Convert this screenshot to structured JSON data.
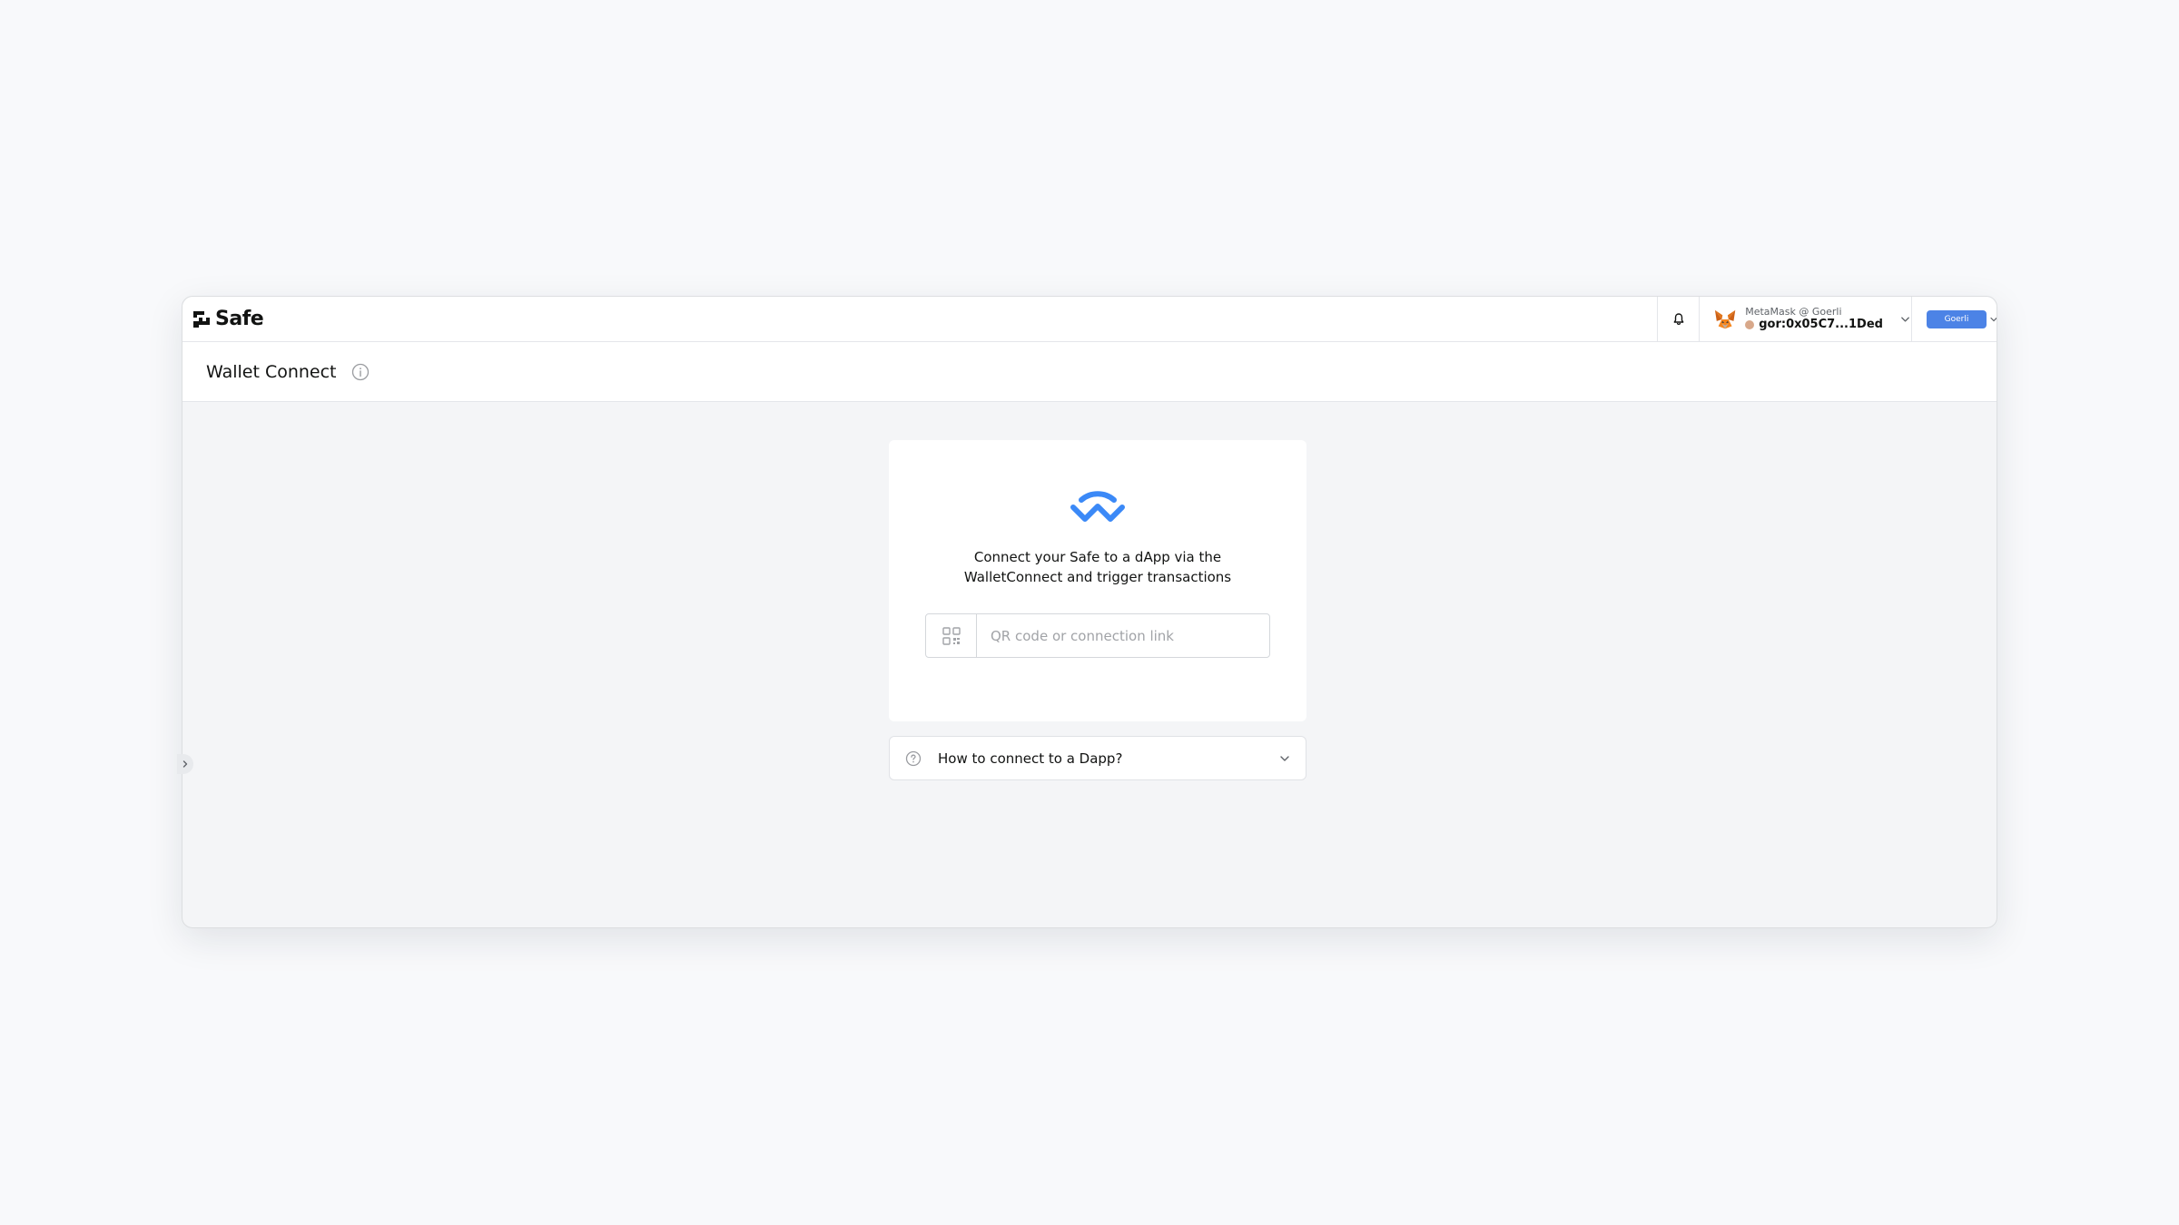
{
  "header": {
    "logo_text": "Safe",
    "wallet": {
      "name": "MetaMask @ Goerli",
      "address": "gor:0x05C7...1Ded"
    },
    "network_label": "Goerli"
  },
  "subheader": {
    "title": "Wallet Connect"
  },
  "connect_card": {
    "description": "Connect your Safe to a dApp via the WalletConnect and trigger transactions",
    "input_placeholder": "QR code or connection link"
  },
  "help_accordion": {
    "label": "How to connect to a Dapp?"
  },
  "colors": {
    "accent": "#4c83e6",
    "walletconnect_blue": "#3b89f7",
    "text": "#121312",
    "muted": "#a1a3a7"
  },
  "icons": {
    "logo": "safe-logo-icon",
    "bell": "bell-icon",
    "wallet": "metamask-fox-icon",
    "chevron": "chevron-down-icon",
    "info": "info-icon",
    "walletconnect": "walletconnect-logo-icon",
    "qr": "qr-code-icon",
    "help": "question-circle-icon",
    "sidebar": "chevron-right-icon"
  }
}
